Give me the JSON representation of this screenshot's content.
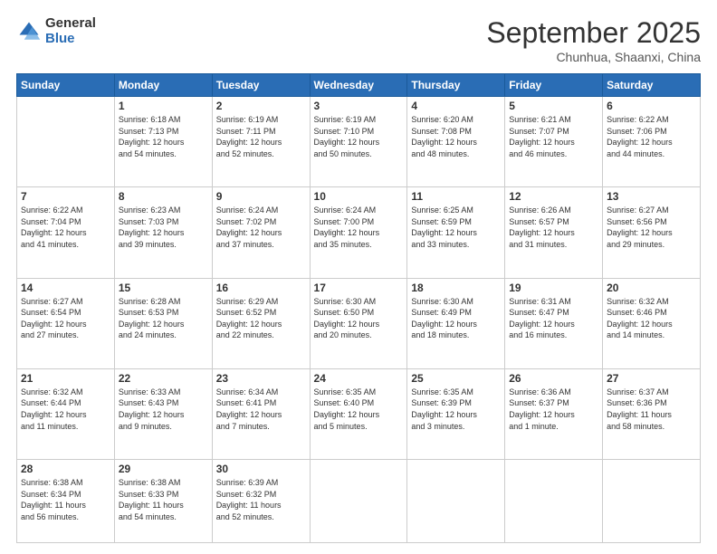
{
  "logo": {
    "general": "General",
    "blue": "Blue"
  },
  "header": {
    "month": "September 2025",
    "location": "Chunhua, Shaanxi, China"
  },
  "weekdays": [
    "Sunday",
    "Monday",
    "Tuesday",
    "Wednesday",
    "Thursday",
    "Friday",
    "Saturday"
  ],
  "weeks": [
    [
      {
        "day": "",
        "info": ""
      },
      {
        "day": "1",
        "info": "Sunrise: 6:18 AM\nSunset: 7:13 PM\nDaylight: 12 hours\nand 54 minutes."
      },
      {
        "day": "2",
        "info": "Sunrise: 6:19 AM\nSunset: 7:11 PM\nDaylight: 12 hours\nand 52 minutes."
      },
      {
        "day": "3",
        "info": "Sunrise: 6:19 AM\nSunset: 7:10 PM\nDaylight: 12 hours\nand 50 minutes."
      },
      {
        "day": "4",
        "info": "Sunrise: 6:20 AM\nSunset: 7:08 PM\nDaylight: 12 hours\nand 48 minutes."
      },
      {
        "day": "5",
        "info": "Sunrise: 6:21 AM\nSunset: 7:07 PM\nDaylight: 12 hours\nand 46 minutes."
      },
      {
        "day": "6",
        "info": "Sunrise: 6:22 AM\nSunset: 7:06 PM\nDaylight: 12 hours\nand 44 minutes."
      }
    ],
    [
      {
        "day": "7",
        "info": "Sunrise: 6:22 AM\nSunset: 7:04 PM\nDaylight: 12 hours\nand 41 minutes."
      },
      {
        "day": "8",
        "info": "Sunrise: 6:23 AM\nSunset: 7:03 PM\nDaylight: 12 hours\nand 39 minutes."
      },
      {
        "day": "9",
        "info": "Sunrise: 6:24 AM\nSunset: 7:02 PM\nDaylight: 12 hours\nand 37 minutes."
      },
      {
        "day": "10",
        "info": "Sunrise: 6:24 AM\nSunset: 7:00 PM\nDaylight: 12 hours\nand 35 minutes."
      },
      {
        "day": "11",
        "info": "Sunrise: 6:25 AM\nSunset: 6:59 PM\nDaylight: 12 hours\nand 33 minutes."
      },
      {
        "day": "12",
        "info": "Sunrise: 6:26 AM\nSunset: 6:57 PM\nDaylight: 12 hours\nand 31 minutes."
      },
      {
        "day": "13",
        "info": "Sunrise: 6:27 AM\nSunset: 6:56 PM\nDaylight: 12 hours\nand 29 minutes."
      }
    ],
    [
      {
        "day": "14",
        "info": "Sunrise: 6:27 AM\nSunset: 6:54 PM\nDaylight: 12 hours\nand 27 minutes."
      },
      {
        "day": "15",
        "info": "Sunrise: 6:28 AM\nSunset: 6:53 PM\nDaylight: 12 hours\nand 24 minutes."
      },
      {
        "day": "16",
        "info": "Sunrise: 6:29 AM\nSunset: 6:52 PM\nDaylight: 12 hours\nand 22 minutes."
      },
      {
        "day": "17",
        "info": "Sunrise: 6:30 AM\nSunset: 6:50 PM\nDaylight: 12 hours\nand 20 minutes."
      },
      {
        "day": "18",
        "info": "Sunrise: 6:30 AM\nSunset: 6:49 PM\nDaylight: 12 hours\nand 18 minutes."
      },
      {
        "day": "19",
        "info": "Sunrise: 6:31 AM\nSunset: 6:47 PM\nDaylight: 12 hours\nand 16 minutes."
      },
      {
        "day": "20",
        "info": "Sunrise: 6:32 AM\nSunset: 6:46 PM\nDaylight: 12 hours\nand 14 minutes."
      }
    ],
    [
      {
        "day": "21",
        "info": "Sunrise: 6:32 AM\nSunset: 6:44 PM\nDaylight: 12 hours\nand 11 minutes."
      },
      {
        "day": "22",
        "info": "Sunrise: 6:33 AM\nSunset: 6:43 PM\nDaylight: 12 hours\nand 9 minutes."
      },
      {
        "day": "23",
        "info": "Sunrise: 6:34 AM\nSunset: 6:41 PM\nDaylight: 12 hours\nand 7 minutes."
      },
      {
        "day": "24",
        "info": "Sunrise: 6:35 AM\nSunset: 6:40 PM\nDaylight: 12 hours\nand 5 minutes."
      },
      {
        "day": "25",
        "info": "Sunrise: 6:35 AM\nSunset: 6:39 PM\nDaylight: 12 hours\nand 3 minutes."
      },
      {
        "day": "26",
        "info": "Sunrise: 6:36 AM\nSunset: 6:37 PM\nDaylight: 12 hours\nand 1 minute."
      },
      {
        "day": "27",
        "info": "Sunrise: 6:37 AM\nSunset: 6:36 PM\nDaylight: 11 hours\nand 58 minutes."
      }
    ],
    [
      {
        "day": "28",
        "info": "Sunrise: 6:38 AM\nSunset: 6:34 PM\nDaylight: 11 hours\nand 56 minutes."
      },
      {
        "day": "29",
        "info": "Sunrise: 6:38 AM\nSunset: 6:33 PM\nDaylight: 11 hours\nand 54 minutes."
      },
      {
        "day": "30",
        "info": "Sunrise: 6:39 AM\nSunset: 6:32 PM\nDaylight: 11 hours\nand 52 minutes."
      },
      {
        "day": "",
        "info": ""
      },
      {
        "day": "",
        "info": ""
      },
      {
        "day": "",
        "info": ""
      },
      {
        "day": "",
        "info": ""
      }
    ]
  ]
}
